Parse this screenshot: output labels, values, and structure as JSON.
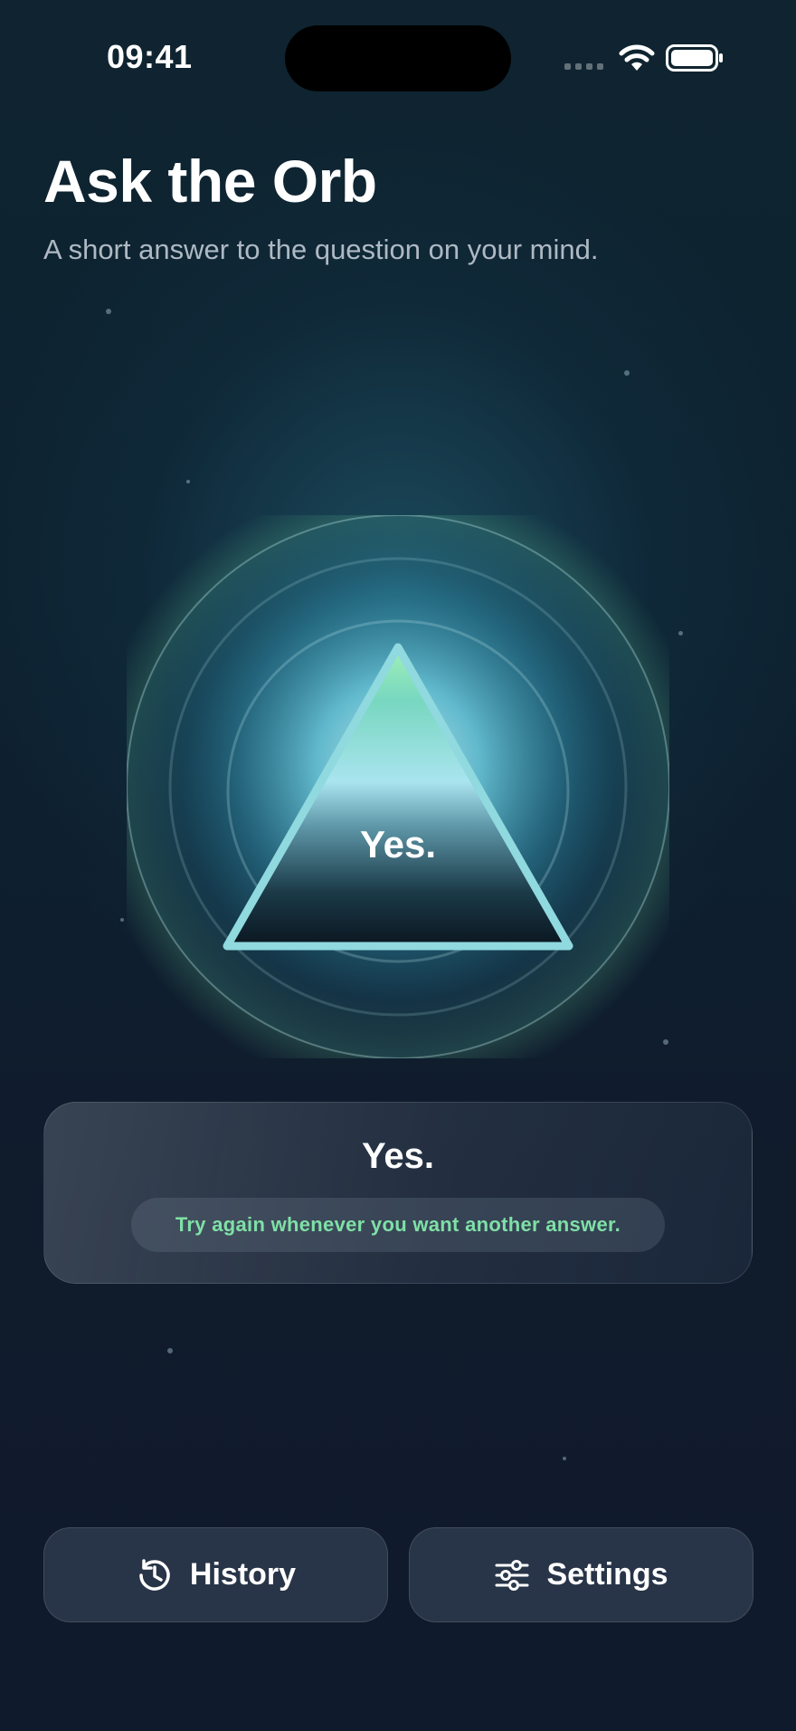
{
  "status_bar": {
    "time": "09:41",
    "icons": [
      "cellular-signal-icon",
      "wifi-icon",
      "battery-icon"
    ]
  },
  "header": {
    "title": "Ask the Orb",
    "subtitle": "A short answer to the question on your mind."
  },
  "orb": {
    "answer": "Yes."
  },
  "answer_card": {
    "answer": "Yes.",
    "hint": "Try again whenever you want another answer."
  },
  "actions": {
    "history_label": "History",
    "history_icon": "history-icon",
    "settings_label": "Settings",
    "settings_icon": "sliders-icon"
  },
  "colors": {
    "accent_green": "#7fe0a6",
    "orb_glow": "#5fd0e6",
    "background": "#0f1a2c"
  }
}
